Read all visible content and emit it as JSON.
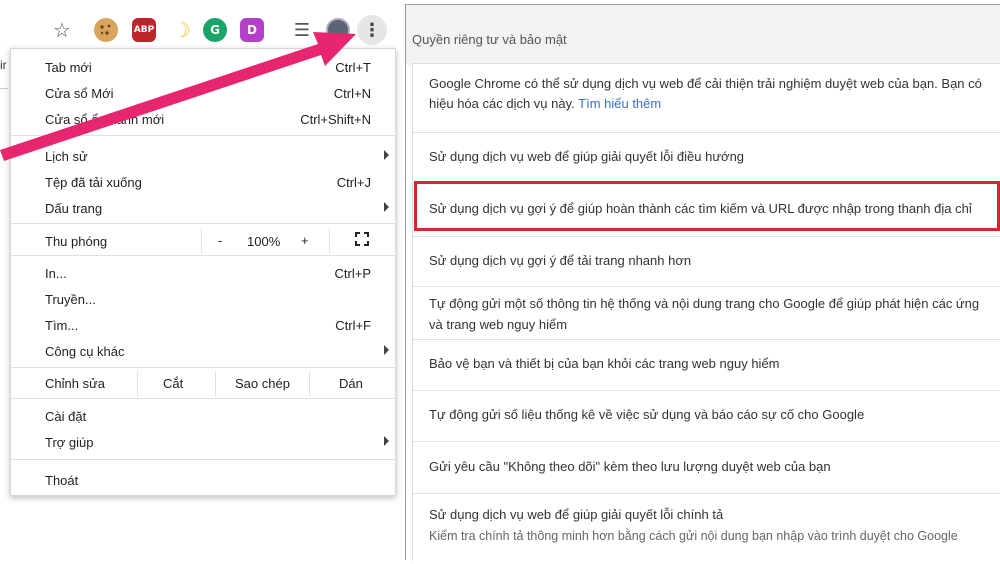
{
  "toolbar": {
    "icons": [
      "star-icon",
      "cookie-icon",
      "adblock-plus-icon",
      "moon-icon",
      "grammarly-icon",
      "d-extension-icon",
      "reading-list-icon",
      "avatar-icon",
      "kebab-menu-icon"
    ],
    "abp_label": "ABP",
    "grammarly_label": "G",
    "d_label": "D",
    "star_glyph": "☆",
    "moon_glyph": "☽",
    "reading_list_glyph": "☰",
    "kebab_glyph": "⋮"
  },
  "left_edge_text": "ir",
  "menu": {
    "items": [
      {
        "label": "Tab mới",
        "shortcut": "Ctrl+T"
      },
      {
        "label": "Cửa sổ Mới",
        "shortcut": "Ctrl+N"
      },
      {
        "label": "Cửa sổ ẩn danh mới",
        "shortcut": "Ctrl+Shift+N"
      },
      {
        "label": "Lịch sử",
        "shortcut": ""
      },
      {
        "label": "Tệp đã tải xuống",
        "shortcut": "Ctrl+J"
      },
      {
        "label": "Dấu trang",
        "shortcut": ""
      },
      {
        "label": "Thu phóng",
        "shortcut": ""
      },
      {
        "label": "In...",
        "shortcut": "Ctrl+P"
      },
      {
        "label": "Truyền...",
        "shortcut": ""
      },
      {
        "label": "Tìm...",
        "shortcut": "Ctrl+F"
      },
      {
        "label": "Công cụ khác",
        "shortcut": ""
      },
      {
        "label": "Chỉnh sửa",
        "shortcut": ""
      },
      {
        "label": "Cài đặt",
        "shortcut": ""
      },
      {
        "label": "Trợ giúp",
        "shortcut": ""
      },
      {
        "label": "Thoát",
        "shortcut": ""
      }
    ],
    "zoom": {
      "minus": "-",
      "value": "100%",
      "plus": "+"
    },
    "edit": {
      "cut": "Cắt",
      "copy": "Sao chép",
      "paste": "Dán"
    }
  },
  "settings": {
    "section_title": "Quyền riêng tư và bảo mật",
    "rows": [
      {
        "line1": "Google Chrome có thể sử dụng dịch vụ web để cải thiện trải nghiệm duyệt web của bạn. Bạn có",
        "line2": "hiệu hóa các dịch vụ này.",
        "link": "Tìm hiểu thêm"
      },
      {
        "line1": "Sử dụng dịch vụ web để giúp giải quyết lỗi điều hướng"
      },
      {
        "line1": "Sử dụng dịch vụ gợi ý để giúp hoàn thành các tìm kiếm và URL được nhập trong thanh địa chỉ"
      },
      {
        "line1": "Sử dụng dịch vụ gợi ý để tải trang nhanh hơn"
      },
      {
        "line1": "Tự động gửi một số thông tin hệ thống và nội dung trang cho Google để giúp phát hiện các ứng",
        "line2": "và trang web nguy hiểm"
      },
      {
        "line1": "Bảo vệ bạn và thiết bị của bạn khỏi các trang web nguy hiểm"
      },
      {
        "line1": "Tự động gửi số liệu thống kê về việc sử dụng và báo cáo sự cố cho Google"
      },
      {
        "line1": "Gửi yêu cầu \"Không theo dõi\" kèm theo lưu lượng duyệt web của bạn"
      },
      {
        "line1": "Sử dụng dịch vụ web để giúp giải quyết lỗi chính tả",
        "line2": "Kiểm tra chính tả thông minh hơn bằng cách gửi nội dung bạn nhập vào trình duyệt cho Google"
      }
    ]
  },
  "colors": {
    "arrow": "#e8266f",
    "highlight": "#d0282e",
    "link": "#3a6fd8"
  }
}
